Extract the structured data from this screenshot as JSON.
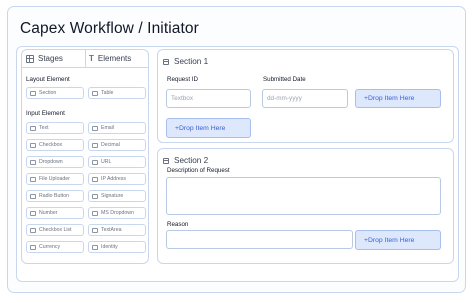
{
  "app": {
    "title": "Capex Workflow / Initiator"
  },
  "left_panel": {
    "tabs": [
      {
        "label": "Stages",
        "icon": "grid-icon"
      },
      {
        "label": "Elements",
        "icon": "text-icon"
      }
    ],
    "layout_group": {
      "title": "Layout Element",
      "items": [
        "Section",
        "Table"
      ]
    },
    "input_group": {
      "title": "Input Element",
      "items": [
        "Text",
        "Email",
        "Checkbox",
        "Decimal",
        "Dropdown",
        "URL",
        "File Uploader",
        "IP Address",
        "Radio Button",
        "Signature",
        "Number",
        "MS Dropdown",
        "Checkbox List",
        "TextArea",
        "Currency",
        "Identity"
      ]
    }
  },
  "section1": {
    "title": "Section 1",
    "request_id_label": "Request ID",
    "request_id_placeholder": "Textbox",
    "submitted_date_label": "Submitted Date",
    "submitted_date_placeholder": "dd-mm-yyyy",
    "drop_item_label": "+Drop Item Here",
    "drop_item_label_2": "+Drop Item Here"
  },
  "section2": {
    "title": "Section 2",
    "description_label": "Description of Request",
    "reason_label": "Reason",
    "drop_item_label": "+Drop Item Here"
  },
  "colors": {
    "border": "#c9d7ee",
    "drop_zone_bg": "#dde8fd",
    "drop_zone_text": "#3b5fd4"
  }
}
